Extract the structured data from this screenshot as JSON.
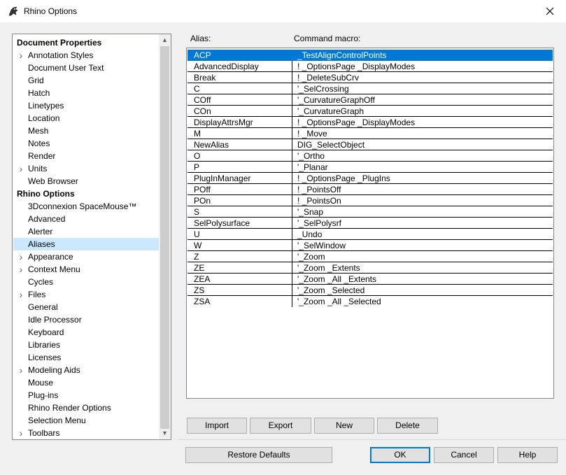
{
  "window": {
    "title": "Rhino Options"
  },
  "tree": {
    "items": [
      {
        "label": "Document Properties",
        "kind": "header"
      },
      {
        "label": "Annotation Styles",
        "kind": "child",
        "expandable": true
      },
      {
        "label": "Document User Text",
        "kind": "child"
      },
      {
        "label": "Grid",
        "kind": "child"
      },
      {
        "label": "Hatch",
        "kind": "child"
      },
      {
        "label": "Linetypes",
        "kind": "child"
      },
      {
        "label": "Location",
        "kind": "child"
      },
      {
        "label": "Mesh",
        "kind": "child"
      },
      {
        "label": "Notes",
        "kind": "child"
      },
      {
        "label": "Render",
        "kind": "child"
      },
      {
        "label": "Units",
        "kind": "child",
        "expandable": true
      },
      {
        "label": "Web Browser",
        "kind": "child"
      },
      {
        "label": "Rhino Options",
        "kind": "header"
      },
      {
        "label": "3Dconnexion SpaceMouse™",
        "kind": "child"
      },
      {
        "label": "Advanced",
        "kind": "child"
      },
      {
        "label": "Alerter",
        "kind": "child"
      },
      {
        "label": "Aliases",
        "kind": "child",
        "selected": true
      },
      {
        "label": "Appearance",
        "kind": "child",
        "expandable": true
      },
      {
        "label": "Context Menu",
        "kind": "child",
        "expandable": true
      },
      {
        "label": "Cycles",
        "kind": "child"
      },
      {
        "label": "Files",
        "kind": "child",
        "expandable": true
      },
      {
        "label": "General",
        "kind": "child"
      },
      {
        "label": "Idle Processor",
        "kind": "child"
      },
      {
        "label": "Keyboard",
        "kind": "child"
      },
      {
        "label": "Libraries",
        "kind": "child"
      },
      {
        "label": "Licenses",
        "kind": "child"
      },
      {
        "label": "Modeling Aids",
        "kind": "child",
        "expandable": true
      },
      {
        "label": "Mouse",
        "kind": "child"
      },
      {
        "label": "Plug-ins",
        "kind": "child"
      },
      {
        "label": "Rhino Render Options",
        "kind": "child"
      },
      {
        "label": "Selection Menu",
        "kind": "child"
      },
      {
        "label": "Toolbars",
        "kind": "child",
        "expandable": true
      }
    ]
  },
  "aliases": {
    "alias_header": "Alias:",
    "macro_header": "Command macro:",
    "rows": [
      {
        "alias": "ACP",
        "macro": "_TestAlignControlPoints",
        "selected": true
      },
      {
        "alias": "AdvancedDisplay",
        "macro": "! _OptionsPage _DisplayModes"
      },
      {
        "alias": "Break",
        "macro": "! _DeleteSubCrv"
      },
      {
        "alias": "C",
        "macro": "'_SelCrossing"
      },
      {
        "alias": "COff",
        "macro": "'_CurvatureGraphOff"
      },
      {
        "alias": "COn",
        "macro": "'_CurvatureGraph"
      },
      {
        "alias": "DisplayAttrsMgr",
        "macro": "! _OptionsPage _DisplayModes"
      },
      {
        "alias": "M",
        "macro": "! _Move"
      },
      {
        "alias": "NewAlias",
        "macro": "DIG_SelectObject"
      },
      {
        "alias": "O",
        "macro": "'_Ortho"
      },
      {
        "alias": "P",
        "macro": "'_Planar"
      },
      {
        "alias": "PlugInManager",
        "macro": "! _OptionsPage _PlugIns"
      },
      {
        "alias": "POff",
        "macro": "! _PointsOff"
      },
      {
        "alias": "POn",
        "macro": "! _PointsOn"
      },
      {
        "alias": "S",
        "macro": "'_Snap"
      },
      {
        "alias": "SelPolysurface",
        "macro": "'_SelPolysrf"
      },
      {
        "alias": "U",
        "macro": "_Undo"
      },
      {
        "alias": "W",
        "macro": "'_SelWindow"
      },
      {
        "alias": "Z",
        "macro": "'_Zoom"
      },
      {
        "alias": "ZE",
        "macro": "'_Zoom _Extents"
      },
      {
        "alias": "ZEA",
        "macro": "'_Zoom _All _Extents"
      },
      {
        "alias": "ZS",
        "macro": "'_Zoom _Selected"
      },
      {
        "alias": "ZSA",
        "macro": "'_Zoom _All _Selected"
      }
    ]
  },
  "buttons": {
    "import": "Import",
    "export": "Export",
    "new": "New",
    "delete": "Delete",
    "restore_defaults": "Restore Defaults",
    "ok": "OK",
    "cancel": "Cancel",
    "help": "Help"
  },
  "colors": {
    "selection": "#0078d7",
    "tree_selection": "#cce8ff"
  }
}
